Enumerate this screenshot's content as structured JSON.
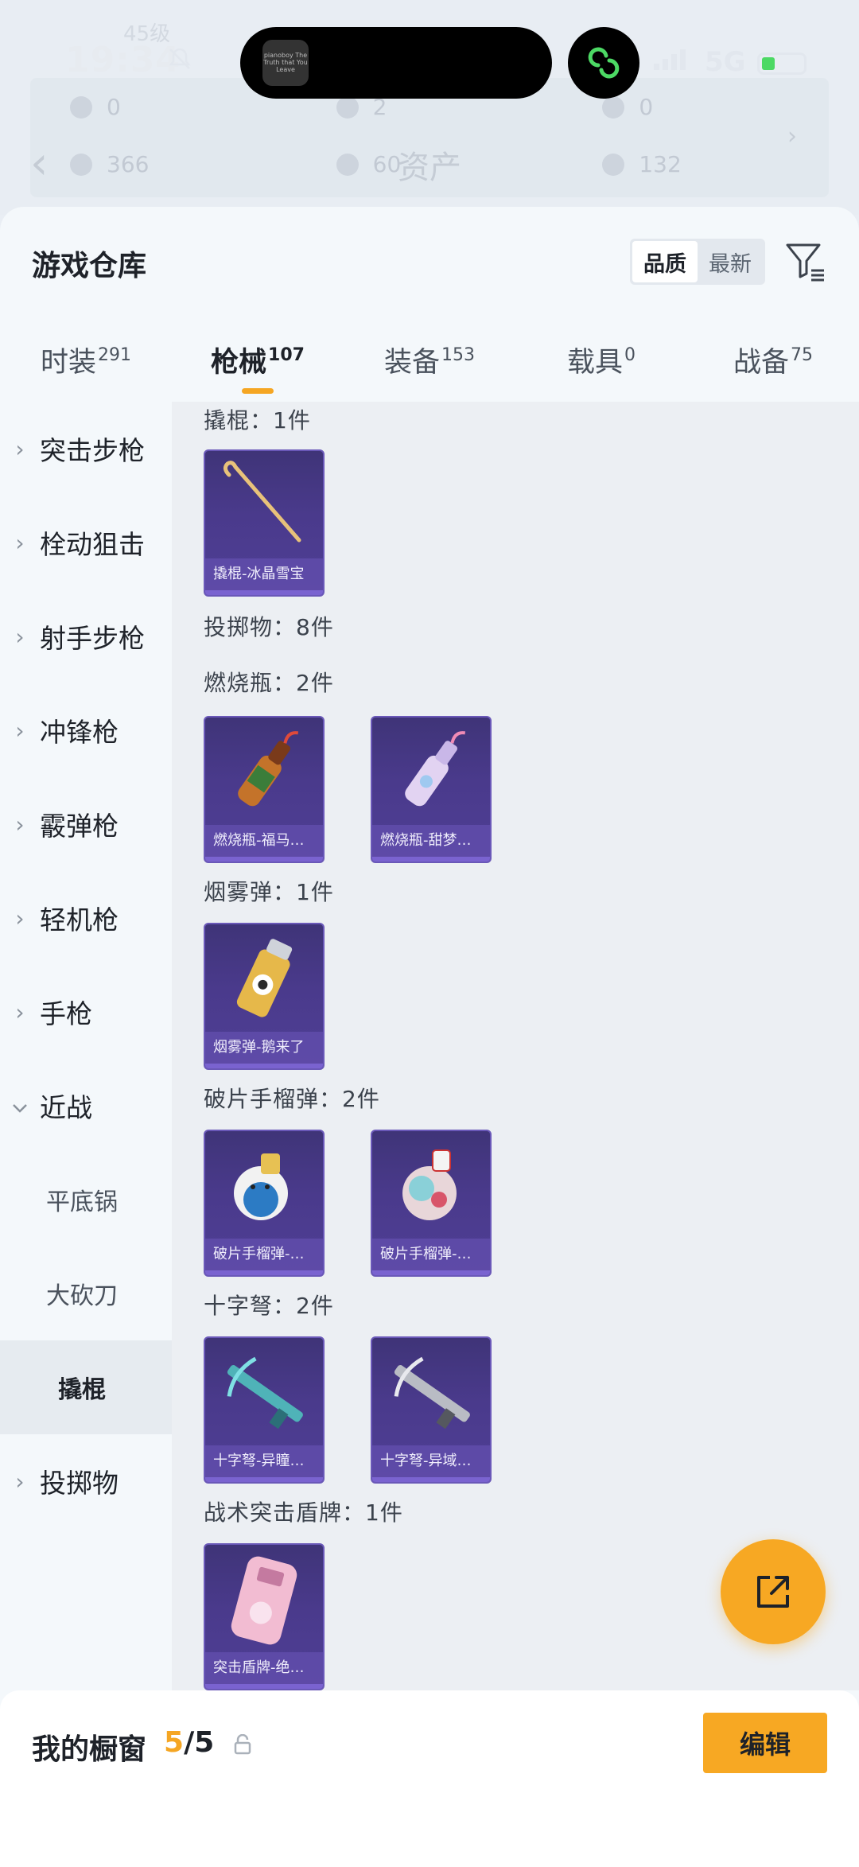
{
  "status_bar": {
    "time": "19:34",
    "network": "5G",
    "island_app": "pianoboy The Truth that You Leave"
  },
  "background": {
    "level": "45级",
    "stats_row1": [
      "0",
      "2",
      "0"
    ],
    "stats_row2": [
      "366",
      "60",
      "132"
    ],
    "page_title": "资产"
  },
  "sheet": {
    "title": "游戏仓库",
    "sort_options": [
      "品质",
      "最新"
    ],
    "sort_active": "品质"
  },
  "tabs": [
    {
      "label": "时装",
      "count": "291"
    },
    {
      "label": "枪械",
      "count": "107"
    },
    {
      "label": "装备",
      "count": "153"
    },
    {
      "label": "载具",
      "count": "0"
    },
    {
      "label": "战备",
      "count": "75"
    }
  ],
  "sidebar": {
    "items": [
      "突击步枪",
      "栓动狙击",
      "射手步枪",
      "冲锋枪",
      "霰弹枪",
      "轻机枪",
      "手枪",
      "近战"
    ],
    "sub_items": [
      "平底锅",
      "大砍刀",
      "撬棍"
    ],
    "last_item": "投掷物"
  },
  "sections": {
    "crowbar_label": "撬棍：1件",
    "throwables_label": "投掷物：8件",
    "molotov_label": "燃烧瓶：2件",
    "smoke_label": "烟雾弹：1件",
    "frag_label": "破片手榴弹：2件",
    "crossbow_label": "十字弩：2件",
    "shield_label": "战术突击盾牌：1件"
  },
  "cards": {
    "crowbar": "撬棍-冰晶雪宝",
    "molotov1": "燃烧瓶-福马…",
    "molotov2": "燃烧瓶-甜梦…",
    "smoke1": "烟雾弹-鹅来了",
    "frag1": "破片手榴弹-…",
    "frag2": "破片手榴弹-…",
    "crossbow1": "十字弩-异瞳…",
    "crossbow2": "十字弩-异域…",
    "shield1": "突击盾牌-绝…"
  },
  "showcase": {
    "title": "我的橱窗",
    "count_current": "5",
    "count_total": "/5",
    "edit_label": "编辑"
  },
  "colors": {
    "accent": "#f5a623",
    "card_purple": "#4a3a8c"
  }
}
